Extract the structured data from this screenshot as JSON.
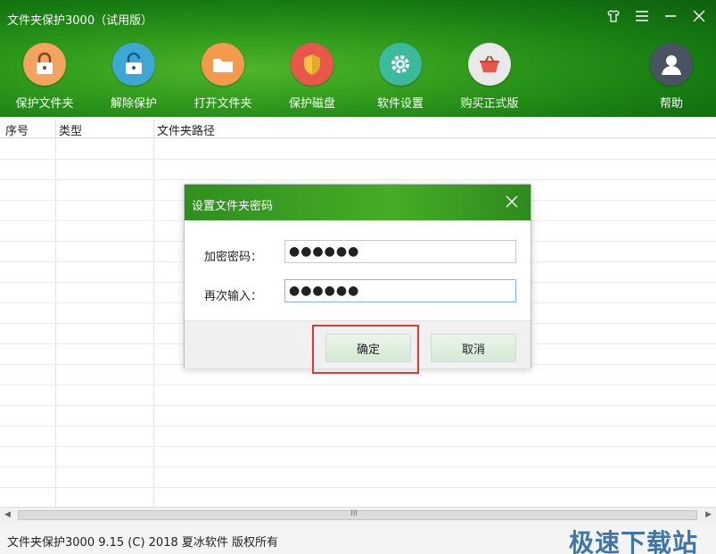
{
  "app": {
    "title": "文件夹保护3000（试用版）"
  },
  "window_controls": [
    {
      "name": "skin-icon",
      "glyph": "👕"
    },
    {
      "name": "menu-icon",
      "glyph": "☰"
    },
    {
      "name": "minimize-icon",
      "glyph": "—"
    },
    {
      "name": "close-icon",
      "glyph": "✕"
    }
  ],
  "toolbar": {
    "protect_folder": "保护文件夹",
    "unprotect": "解除保护",
    "open_folder": "打开文件夹",
    "protect_disk": "保护磁盘",
    "settings": "软件设置",
    "buy": "购买正式版",
    "help": "帮助"
  },
  "table": {
    "headers": [
      "序号",
      "类型",
      "文件夹路径"
    ]
  },
  "dialog": {
    "title": "设置文件夹密码",
    "password_label": "加密密码：",
    "password_value": "●●●●●●",
    "confirm_label": "再次输入：",
    "confirm_value": "●●●●●●",
    "ok_label": "确定",
    "cancel_label": "取消"
  },
  "scrollbar": {
    "grip": "III"
  },
  "status": {
    "text": "文件夹保护3000 9.15 (C) 2018 夏冰软件 版权所有",
    "watermark": "极速下载站"
  },
  "colors": {
    "accent_green": "#2f9a1c",
    "highlight_red": "#d93a3a"
  }
}
